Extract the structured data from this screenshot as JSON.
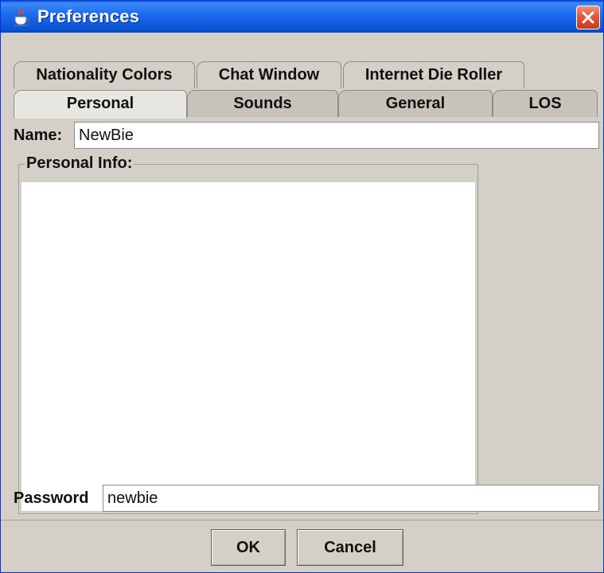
{
  "window": {
    "title": "Preferences",
    "app_icon": "java-coffee-cup-icon",
    "close_icon": "close-x-icon"
  },
  "tabs": {
    "back_row": [
      "Nationality Colors",
      "Chat Window",
      "Internet Die Roller"
    ],
    "front_row": [
      "Personal",
      "Sounds",
      "General",
      "LOS"
    ],
    "active": "Personal"
  },
  "personal": {
    "name_label": "Name:",
    "name_value": "NewBie",
    "personal_info_title": "Personal Info:",
    "personal_info_value": "",
    "password_label": "Password",
    "password_value": "newbie"
  },
  "buttons": {
    "ok": "OK",
    "cancel": "Cancel"
  },
  "colors": {
    "title_bar": "#0a56d6",
    "window_bg": "#d4d0c8",
    "close_button": "#e25a3c"
  }
}
